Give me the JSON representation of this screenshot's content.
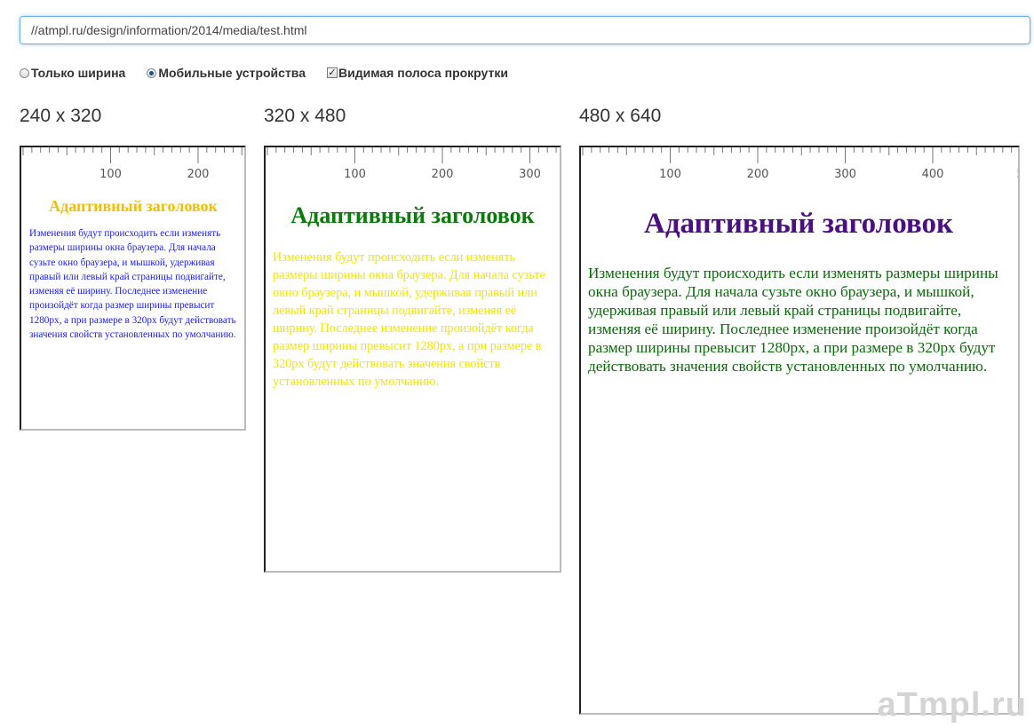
{
  "url_bar": {
    "value": "//atmpl.ru/design/information/2014/media/test.html"
  },
  "options": [
    {
      "label": "Только ширина",
      "type": "radio",
      "checked": false
    },
    {
      "label": "Мобильные устройства",
      "type": "radio",
      "checked": true
    },
    {
      "label": "Видимая полоса прокрутки",
      "type": "checkbox",
      "checked": true
    }
  ],
  "viewports": [
    {
      "label": "240 x 320",
      "ruler_ticks": [
        "100",
        "200"
      ],
      "heading": "Адаптивный заголовок",
      "heading_color": "#f0c000",
      "text": "Изменения будут происходить если изменять размеры ширины окна браузера. Для начала сузьте окно браузера, и мышкой, удерживая правый или левый край страницы подвигайте, изменяя её ширину. Последнее изменение произойдёт когда размер ширины превысит 1280px, а при размере в 320px будут действовать значения свойств установленных по умолчанию.",
      "text_color": "#1a1aff"
    },
    {
      "label": "320 x 480",
      "ruler_ticks": [
        "100",
        "200",
        "300"
      ],
      "heading": "Адаптивный заголовок",
      "heading_color": "#0a7a0a",
      "text": "Изменения будут происходить если изменять размеры ширины окна браузера. Для начала сузьте окно браузера, и мышкой, удерживая правый или левый край страницы подвигайте, изменяя её ширину. Последнее изменение произойдёт когда размер ширины превысит 1280px, а при размере в 320px будут действовать значения свойств установленных по умолчанию.",
      "text_color": "#f2e600"
    },
    {
      "label": "480 x 640",
      "ruler_ticks": [
        "100",
        "200",
        "300",
        "400",
        "5"
      ],
      "heading": "Адаптивный заголовок",
      "heading_color": "#4b0f82",
      "text": "Изменения будут происходить если изменять размеры ширины окна браузера. Для начала сузьте окно браузера, и мышкой, удерживая правый или левый край страницы подвигайте, изменяя её ширину. Последнее изменение произойдёт когда размер ширины превысит 1280px, а при размере в 320px будут действовать значения свойств установленных по умолчанию.",
      "text_color": "#0a6a0a"
    }
  ],
  "watermark": "aTmpl.ru"
}
